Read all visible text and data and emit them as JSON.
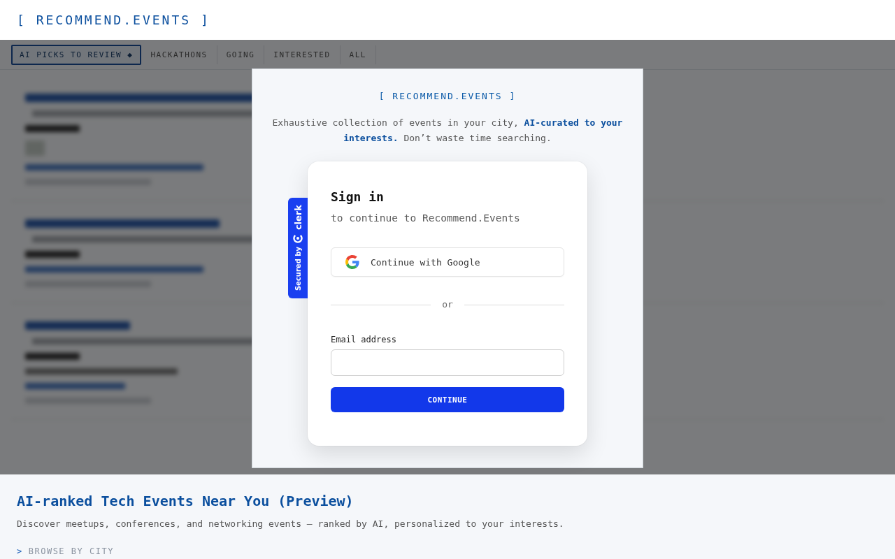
{
  "header": {
    "logo": "[ RECOMMEND.EVENTS ]"
  },
  "tabs": [
    {
      "label": "AI PICKS TO REVIEW ◆",
      "selected": true
    },
    {
      "label": "HACKATHONS",
      "selected": false
    },
    {
      "label": "GOING",
      "selected": false
    },
    {
      "label": "INTERESTED",
      "selected": false
    },
    {
      "label": "ALL",
      "selected": false
    }
  ],
  "modal": {
    "logo": "[ RECOMMEND.EVENTS ]",
    "tagline": "Exhaustive collection of events in your city, **AI-curated to your interests.** Don’t waste time searching.",
    "badge": {
      "label": "Secured by",
      "brand": "clerk"
    },
    "sign_in": {
      "title": "Sign in",
      "subtitle": "to continue to Recommend.Events",
      "social_button": "Continue with Google",
      "divider": "or",
      "email_label": "Email address",
      "submit_button": "CONTINUE"
    }
  },
  "intro": {
    "title": "AI-ranked Tech Events Near You (Preview)",
    "description": "Discover meetups, conferences, and networking events — ranked by AI, personalized to your interests.",
    "link": {
      "marker": ">",
      "label": "BROWSE BY CITY"
    }
  }
}
